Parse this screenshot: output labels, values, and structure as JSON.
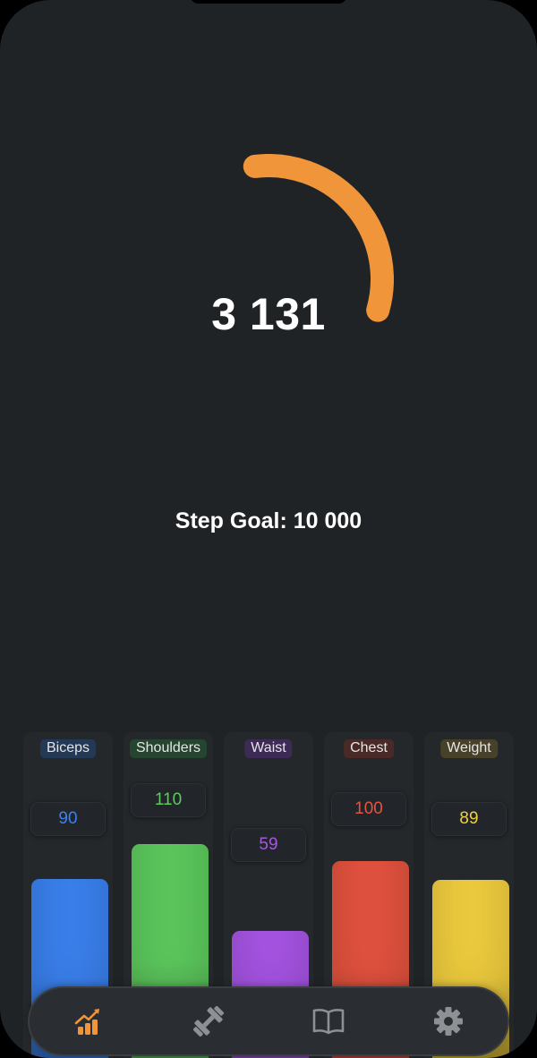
{
  "steps": {
    "count": "3 131",
    "goal_label": "Step Goal: 10 000",
    "progress_fraction": 0.3131,
    "ring_color": "#F0953A"
  },
  "measurements": [
    {
      "label": "Biceps",
      "value": "90",
      "color": "#3B82F0",
      "label_bg": "#243955",
      "value_color": "#3B82F0"
    },
    {
      "label": "Shoulders",
      "value": "110",
      "color": "#5DCB5D",
      "label_bg": "#254531",
      "value_color": "#5DCB5D"
    },
    {
      "label": "Waist",
      "value": "59",
      "color": "#A855E6",
      "label_bg": "#3D2B55",
      "value_color": "#A855E6"
    },
    {
      "label": "Chest",
      "value": "100",
      "color": "#E5533F",
      "label_bg": "#4A2A27",
      "value_color": "#E5533F"
    },
    {
      "label": "Weight",
      "value": "89",
      "color": "#F2CF3F",
      "label_bg": "#47412A",
      "value_color": "#F2CF3F"
    }
  ],
  "tabbar": {
    "tabs": [
      {
        "name": "progress",
        "icon": "chart-up-icon",
        "active": true
      },
      {
        "name": "workouts",
        "icon": "dumbbell-icon",
        "active": false
      },
      {
        "name": "journal",
        "icon": "book-icon",
        "active": false
      },
      {
        "name": "settings",
        "icon": "gear-icon",
        "active": false
      }
    ],
    "active_color": "#F0953A",
    "inactive_color": "#8E9194"
  }
}
